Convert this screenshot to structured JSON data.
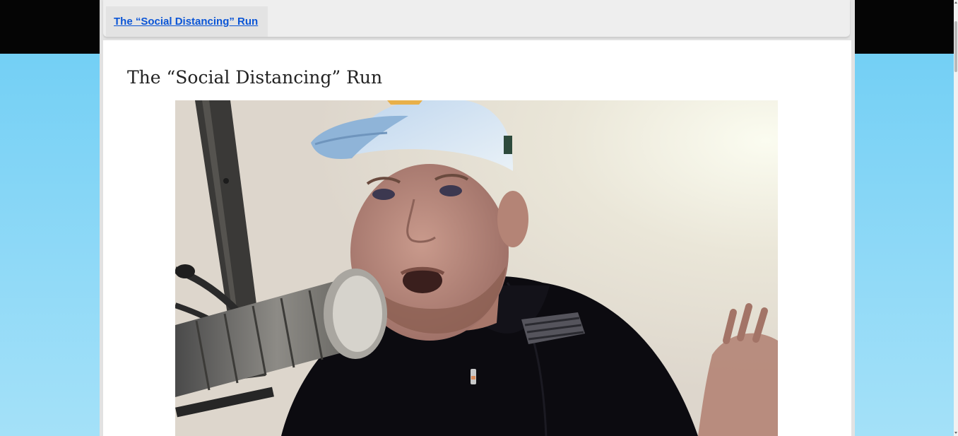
{
  "nav": {
    "tab_label": "The “Social Distancing” Run"
  },
  "post": {
    "title": "The “Social Distancing” Run",
    "video_subject": "man-in-cap-speaking-into-microphone"
  },
  "colors": {
    "background_sky": "#6ccdf4",
    "header_band": "#050505",
    "link": "#0b55d6",
    "title_text": "#222222"
  }
}
